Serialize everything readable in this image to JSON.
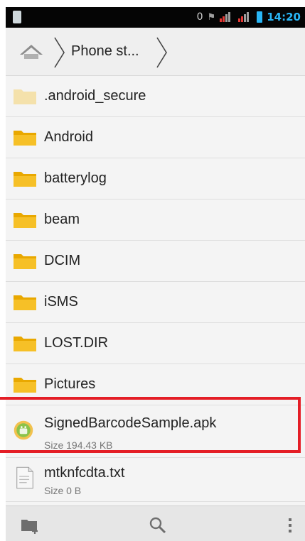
{
  "status_bar": {
    "left_icon": "sim-card-icon",
    "indicator": "0",
    "time": "14:20",
    "icons": [
      "data-indicator-icon",
      "signal-icon",
      "signal-icon",
      "battery-icon"
    ]
  },
  "breadcrumb": {
    "home_icon": "home-icon",
    "current": "Phone st..."
  },
  "files": [
    {
      "name": ".android_secure",
      "type": "folder",
      "icon": "folder-icon",
      "faded": true
    },
    {
      "name": "Android",
      "type": "folder",
      "icon": "folder-icon"
    },
    {
      "name": "batterylog",
      "type": "folder",
      "icon": "folder-icon"
    },
    {
      "name": "beam",
      "type": "folder",
      "icon": "folder-icon"
    },
    {
      "name": "DCIM",
      "type": "folder",
      "icon": "folder-icon"
    },
    {
      "name": "iSMS",
      "type": "folder",
      "icon": "folder-icon"
    },
    {
      "name": "LOST.DIR",
      "type": "folder",
      "icon": "folder-icon"
    },
    {
      "name": "Pictures",
      "type": "folder",
      "icon": "folder-icon"
    },
    {
      "name": "SignedBarcodeSample.apk",
      "size": "Size 194.43 KB",
      "type": "apk",
      "icon": "android-apk-icon",
      "highlighted": true
    },
    {
      "name": "mtknfcdta.txt",
      "size": "Size 0 B",
      "type": "txt",
      "icon": "text-file-icon"
    }
  ],
  "toolbar": {
    "buttons": [
      "new-folder-icon",
      "search-icon",
      "overflow-menu-icon"
    ]
  },
  "colors": {
    "highlight": "#e41e26",
    "folder": "#f6c027",
    "status_accent": "#29b6f6"
  }
}
